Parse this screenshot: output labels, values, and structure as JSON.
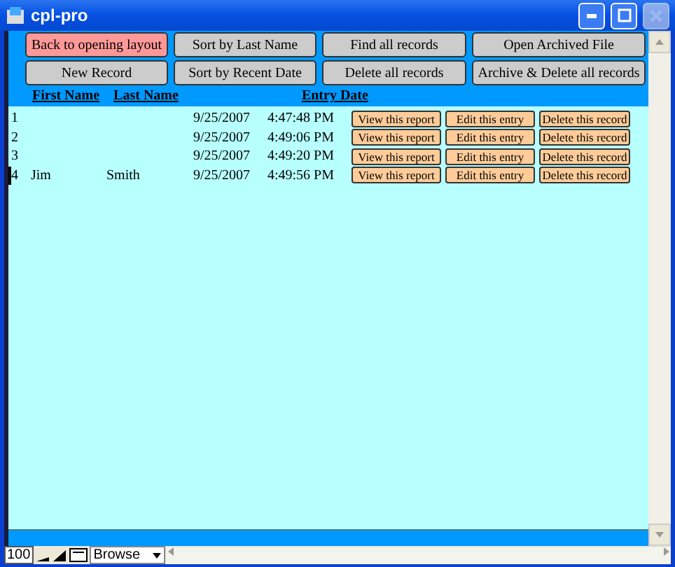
{
  "window": {
    "title": "cpl-pro"
  },
  "header_buttons": [
    {
      "label": "Back to opening layout",
      "kind": "highlight"
    },
    {
      "label": "Sort by Last Name",
      "kind": "normal"
    },
    {
      "label": "Find all records",
      "kind": "normal"
    },
    {
      "label": "Open Archived File",
      "kind": "normal"
    },
    {
      "label": "New Record",
      "kind": "normal"
    },
    {
      "label": "Sort by Recent Date",
      "kind": "normal"
    },
    {
      "label": "Delete all records",
      "kind": "normal"
    },
    {
      "label": "Archive & Delete all records",
      "kind": "normal"
    }
  ],
  "columns": {
    "first_name": "First Name",
    "last_name": "Last Name",
    "entry_date": "Entry Date"
  },
  "rows": [
    {
      "number": "1",
      "first_name": "",
      "last_name": "",
      "date": "9/25/2007",
      "time": "4:47:48 PM",
      "actions": [
        "View this report",
        "Edit this entry",
        "Delete this record"
      ],
      "selected": false
    },
    {
      "number": "2",
      "first_name": "",
      "last_name": "",
      "date": "9/25/2007",
      "time": "4:49:06 PM",
      "actions": [
        "View this report",
        "Edit this entry",
        "Delete this record"
      ],
      "selected": false
    },
    {
      "number": "3",
      "first_name": "",
      "last_name": "",
      "date": "9/25/2007",
      "time": "4:49:20 PM",
      "actions": [
        "View this report",
        "Edit this entry",
        "Delete this record"
      ],
      "selected": false
    },
    {
      "number": "4",
      "first_name": "Jim",
      "last_name": "Smith",
      "date": "9/25/2007",
      "time": "4:49:56 PM",
      "actions": [
        "View this report",
        "Edit this entry",
        "Delete this record"
      ],
      "selected": true
    }
  ],
  "status_bar": {
    "zoom": "100",
    "mode": "Browse"
  }
}
